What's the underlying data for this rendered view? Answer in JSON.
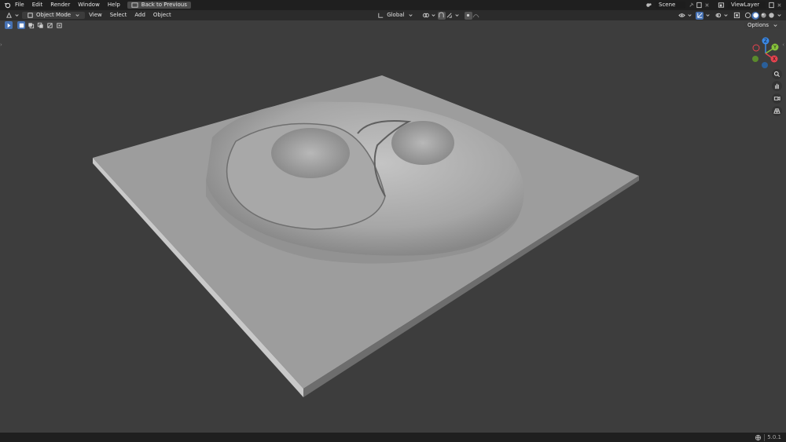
{
  "topbar": {
    "menus": [
      "File",
      "Edit",
      "Render",
      "Window",
      "Help"
    ],
    "back_button": "Back to Previous",
    "scene_label": "Scene",
    "viewlayer_label": "ViewLayer"
  },
  "header": {
    "mode": "Object Mode",
    "menus": [
      "View",
      "Select",
      "Add",
      "Object"
    ],
    "transform_orientation": "Global",
    "options_label": "Options"
  },
  "gizmo": {
    "axes": [
      "X",
      "Y",
      "Z"
    ],
    "colors": {
      "x": "#e8434f",
      "y": "#86c23a",
      "z": "#3a89e8"
    }
  },
  "nav_icons": [
    "zoom-icon",
    "pan-hand-icon",
    "camera-icon",
    "perspective-grid-icon"
  ],
  "status": {
    "version": "5.0.1"
  },
  "colors": {
    "accent": "#4772b3",
    "viewport_bg": "#3d3d3d",
    "header_bg": "#2b2b2b"
  }
}
